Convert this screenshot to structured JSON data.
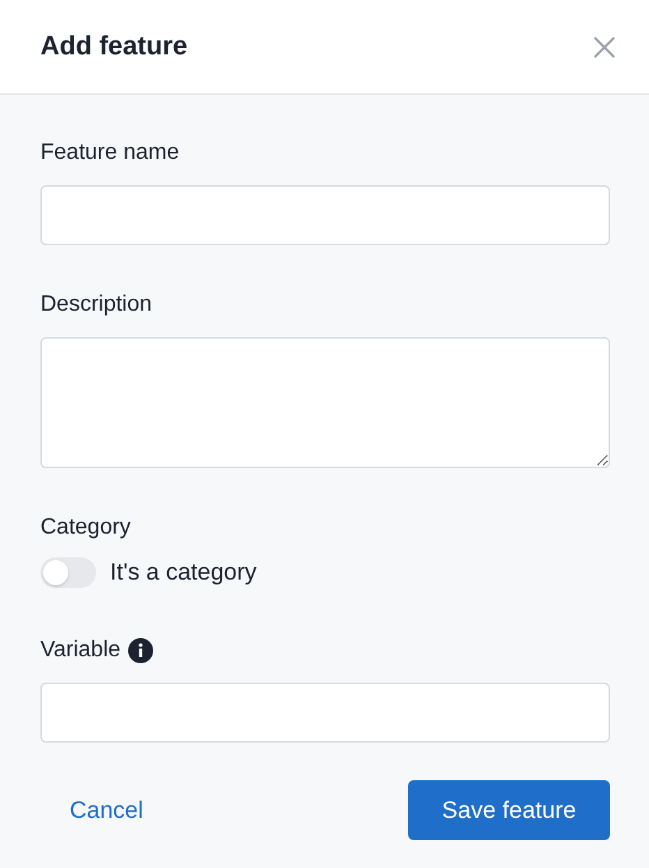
{
  "dialog": {
    "title": "Add feature"
  },
  "fields": [
    {
      "kind": "input",
      "label": "Feature name"
    },
    {
      "kind": "textarea",
      "label": "Description"
    },
    {
      "kind": "toggle",
      "label": "Category",
      "toggle_label": "It's a category",
      "on": false
    },
    {
      "kind": "input",
      "label": "Variable",
      "info": true
    }
  ],
  "buttons": {
    "cancel": "Cancel",
    "save": "Save feature"
  }
}
